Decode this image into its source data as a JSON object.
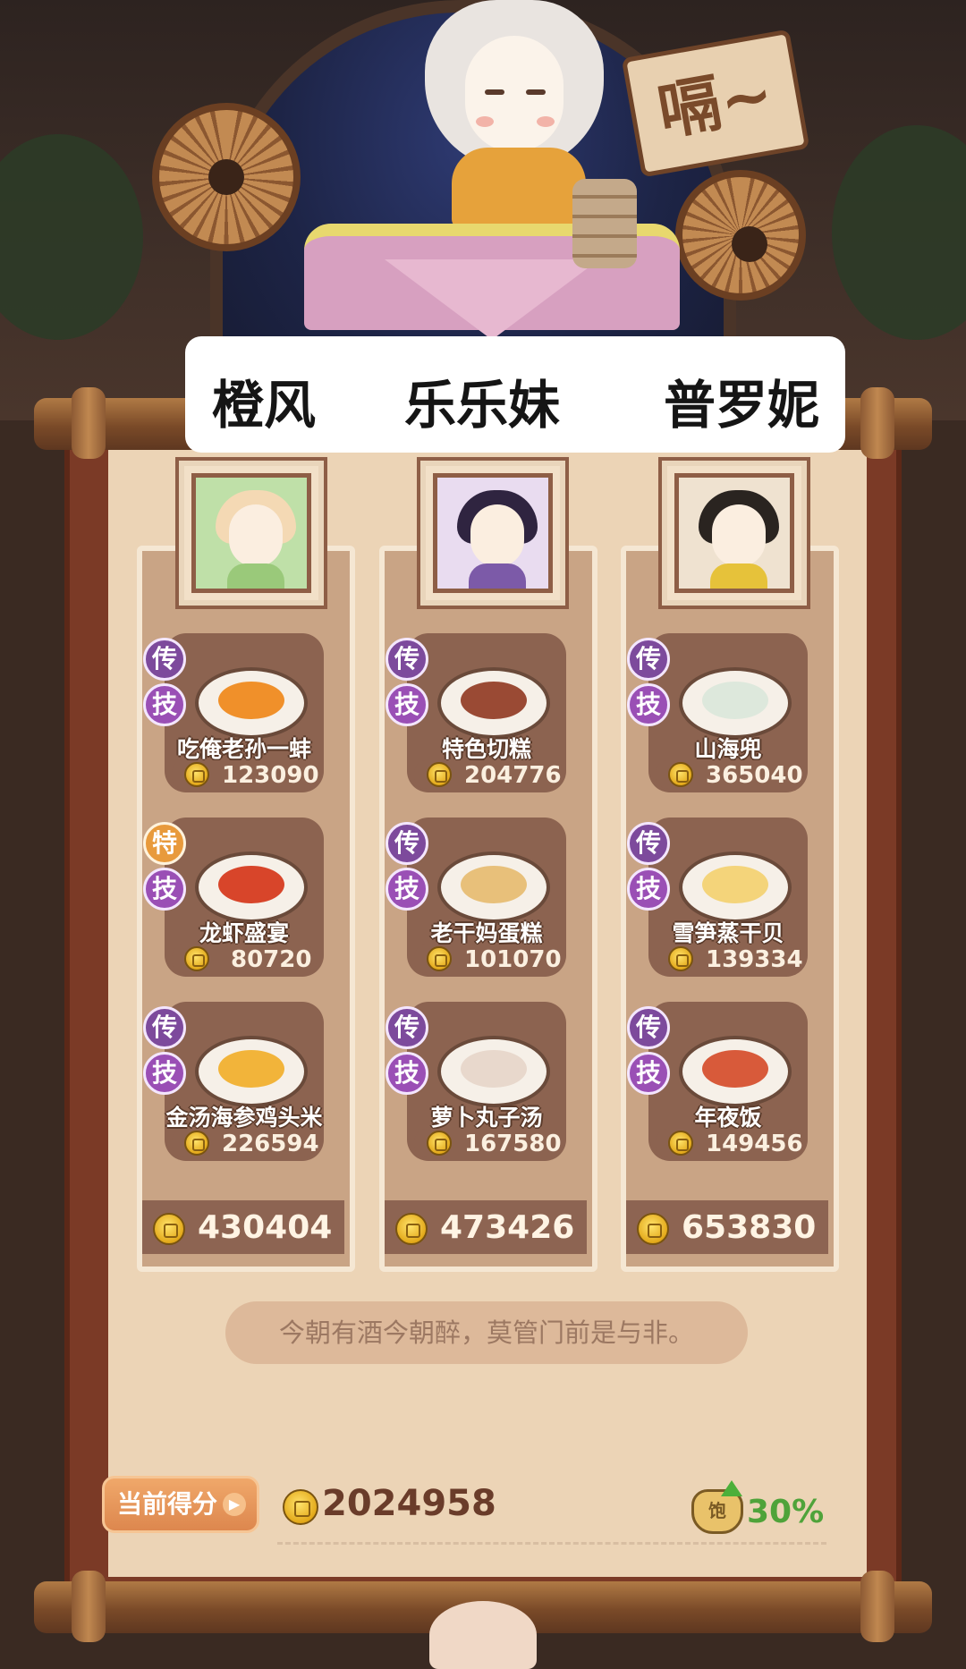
{
  "header": {
    "sign_text": "嗝~",
    "players": [
      "橙风",
      "乐乐妹",
      "普罗妮"
    ]
  },
  "columns": [
    {
      "character": "橙风",
      "dishes": [
        {
          "badge_top": "传",
          "badge_bottom": "技",
          "name": "吃俺老孙一蚌",
          "price": "123090"
        },
        {
          "badge_top": "特",
          "badge_bottom": "技",
          "name": "龙虾盛宴",
          "price": "80720"
        },
        {
          "badge_top": "传",
          "badge_bottom": "技",
          "name": "金汤海参鸡头米",
          "price": "226594"
        }
      ],
      "total": "430404"
    },
    {
      "character": "乐乐妹",
      "dishes": [
        {
          "badge_top": "传",
          "badge_bottom": "技",
          "name": "特色切糕",
          "price": "204776"
        },
        {
          "badge_top": "传",
          "badge_bottom": "技",
          "name": "老干妈蛋糕",
          "price": "101070"
        },
        {
          "badge_top": "传",
          "badge_bottom": "技",
          "name": "萝卜丸子汤",
          "price": "167580"
        }
      ],
      "total": "473426"
    },
    {
      "character": "普罗妮",
      "dishes": [
        {
          "badge_top": "传",
          "badge_bottom": "技",
          "name": "山海兜",
          "price": "365040"
        },
        {
          "badge_top": "传",
          "badge_bottom": "技",
          "name": "雪笋蒸干贝",
          "price": "139334"
        },
        {
          "badge_top": "传",
          "badge_bottom": "技",
          "name": "年夜饭",
          "price": "149456"
        }
      ],
      "total": "653830"
    }
  ],
  "quote": "今朝有酒今朝醉，莫管门前是与非。",
  "score": {
    "label": "当前得分",
    "value": "2024958",
    "bonus": "30%"
  },
  "colors": {
    "legend_badge": "#7d4a9c",
    "special_badge": "#e89a3c",
    "bonus_green": "#4fa33a",
    "coin_gold": "#e3a91a"
  }
}
